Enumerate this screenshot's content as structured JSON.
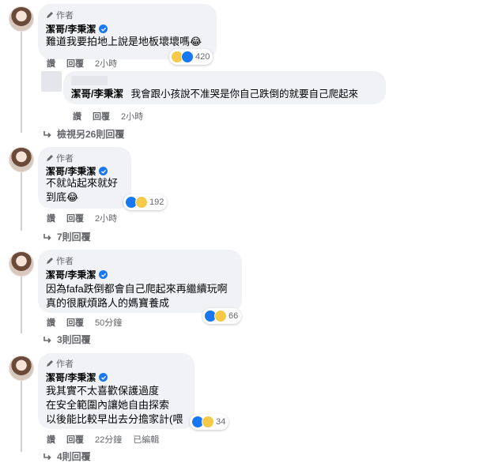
{
  "author_tag": "作者",
  "comments": [
    {
      "name": "潔哥/李秉潔",
      "lines": [
        "難道我要拍地上說是地板壞壞嗎😂"
      ],
      "reply": "回覆",
      "like": "讚",
      "time": "2小時",
      "reaction_count": "420"
    },
    {
      "name": "潔哥/李秉潔",
      "lines": [
        "不就站起來就好",
        "到底😂"
      ],
      "reply": "回覆",
      "like": "讚",
      "time": "2小時",
      "reaction_count": "192"
    },
    {
      "name": "潔哥/李秉潔",
      "lines": [
        "因為fafa跌倒都會自己爬起來再繼續玩啊",
        "真的很厭煩路人的媽寶養成"
      ],
      "reply": "回覆",
      "like": "讚",
      "time": "50分鐘",
      "reaction_count": "66"
    },
    {
      "name": "潔哥/李秉潔",
      "lines": [
        "我其實不太喜歡保護過度",
        "在安全範圍內讓她自由探索",
        "以後能比較早出去分擔家計(喂"
      ],
      "reply": "回覆",
      "like": "讚",
      "time": "22分鐘",
      "edited": "已編輯",
      "reaction_count": "34"
    }
  ],
  "nested_reply": {
    "name": "潔哥/李秉潔",
    "text": "我會跟小孩說不准哭是你自己跌倒的就要自己爬起來",
    "like": "讚",
    "reply": "回覆",
    "time": "2小時"
  },
  "view_more": [
    "檢視另26則回覆",
    "7則回覆",
    "3則回覆",
    "4則回覆"
  ],
  "icons": {
    "verified": "verified-badge-icon",
    "pencil": "pencil-icon",
    "reply_arrow": "reply-arrow-icon",
    "like": "like-icon",
    "haha": "haha-icon"
  },
  "colors": {
    "bubble": "#f0f2f5",
    "verified": "#1877f2",
    "meta": "#65676b"
  }
}
